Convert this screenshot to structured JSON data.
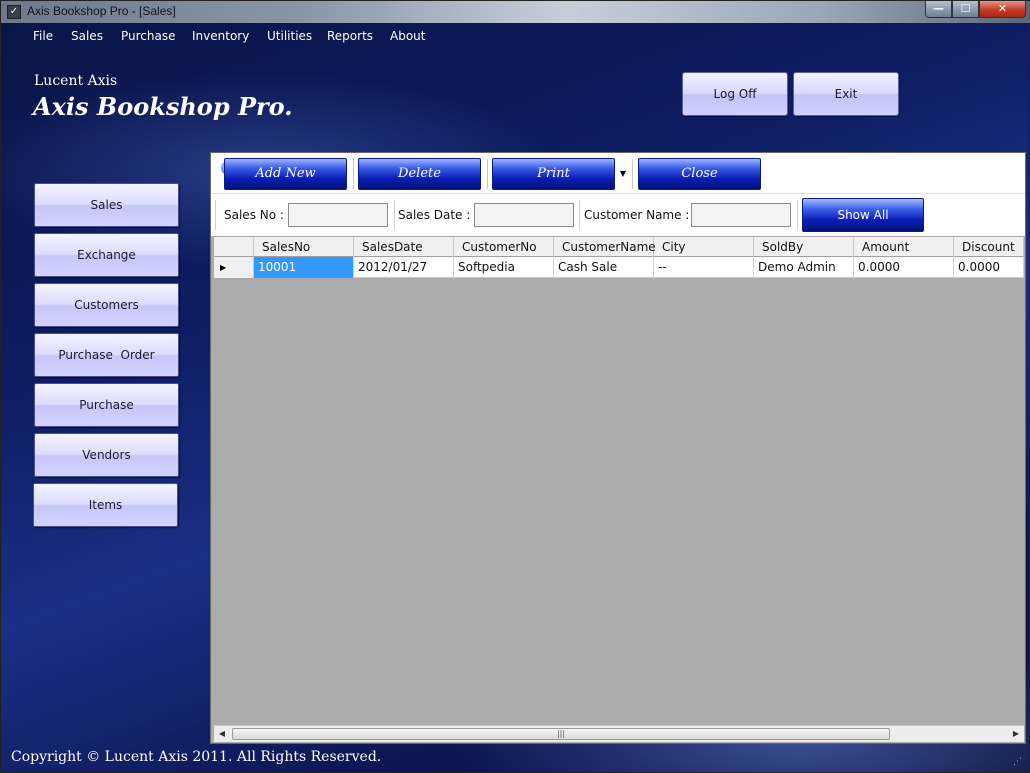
{
  "window": {
    "title": "Axis Bookshop Pro - [Sales]",
    "controls": {
      "minimize": "—",
      "maximize": "☐",
      "close": "✕"
    }
  },
  "menu": [
    "File",
    "Sales",
    "Purchase",
    "Inventory",
    "Utilities",
    "Reports",
    "About"
  ],
  "brand": {
    "company": "Lucent Axis",
    "product": "Axis Bookshop Pro."
  },
  "top_buttons": {
    "logoff": "Log Off",
    "exit": "Exit"
  },
  "sidebar": {
    "items": [
      {
        "label": "Sales"
      },
      {
        "label": "Exchange"
      },
      {
        "label": "Customers"
      },
      {
        "label": "Purchase  Order"
      },
      {
        "label": "Purchase"
      },
      {
        "label": "Vendors"
      },
      {
        "label": "Items"
      }
    ]
  },
  "toolbar": {
    "add_new": "Add New",
    "delete": "Delete",
    "print": "Print",
    "close": "Close",
    "dropdown_arrow": "▼"
  },
  "filters": {
    "sales_no_label": "Sales No :",
    "sales_no_value": "",
    "sales_date_label": "Sales Date :",
    "sales_date_value": "",
    "customer_name_label": "Customer Name :",
    "customer_name_value": "",
    "show_all": "Show All"
  },
  "grid": {
    "columns": [
      "SalesNo",
      "SalesDate",
      "CustomerNo",
      "CustomerName",
      "City",
      "SoldBy",
      "Amount",
      "Discount"
    ],
    "rows": [
      {
        "indicator": "▶",
        "cells": [
          "10001",
          "2012/01/27",
          "Softpedia",
          "Cash Sale",
          "--",
          "Demo Admin",
          "0.0000",
          "0.0000"
        ]
      }
    ]
  },
  "footer": {
    "copyright": "Copyright © Lucent Axis 2011. All Rights Reserved."
  },
  "colors": {
    "background": "#0e1d63",
    "toolbar_button": "#0a1fb6",
    "nav_button": "#d7d8ff",
    "grid_area": "#ababab",
    "selected_cell": "#3399ff"
  }
}
